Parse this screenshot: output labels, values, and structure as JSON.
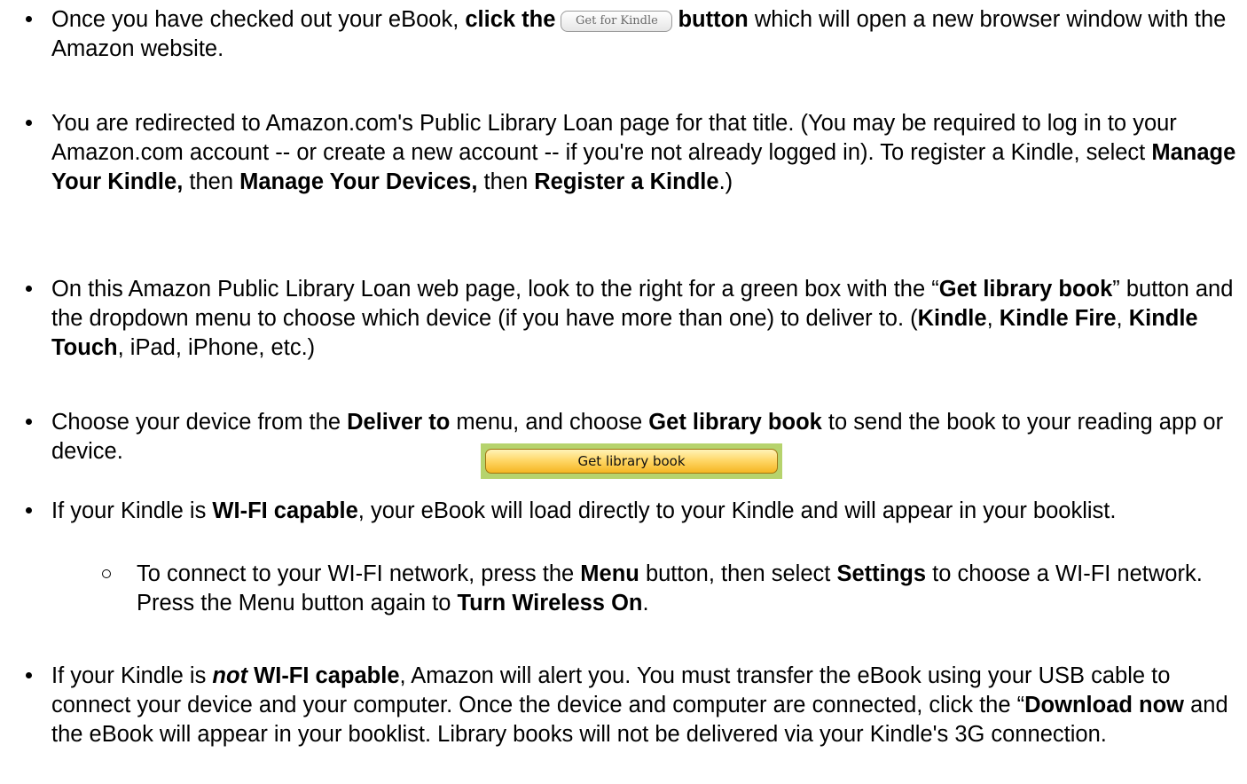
{
  "items": [
    {
      "a": "Once you have checked out your eBook, ",
      "b": "click the",
      "button": "Get for Kindle",
      "c": "button",
      "d": " which will open a new browser window with the Amazon website."
    },
    {
      "a": "You are redirected to Amazon.com's Public Library Loan page for that title. (You may be required to log in to your Amazon.com account -- or create a new account -- if you're not already logged in). To register a Kindle, select ",
      "b": "Manage Your Kindle,",
      "c": " then ",
      "d": "Manage Your Devices,",
      "e": " then ",
      "f": "Register a Kindle",
      "g": ".)"
    },
    {
      "a": "On this Amazon Public Library Loan  web page,  look to the right for a green box with the “",
      "b": "Get library book",
      "c": "” button and the dropdown menu to choose which device (if you have more than one) to deliver to. (",
      "d": "Kindle",
      "e": ", ",
      "f": "Kindle Fire",
      "g": ", ",
      "h": "Kindle Touch",
      "i": ", iPad, iPhone, etc.)"
    },
    {
      "a": "Choose your device from the ",
      "b": "Deliver to",
      "c": " menu, and choose ",
      "d": "Get library book",
      "e": " to send the book to your reading app or device.",
      "button": "Get library book"
    },
    {
      "a": "If your Kindle is ",
      "b": "WI-FI capable",
      "c": ", your eBook will load directly to your Kindle and will appear in your booklist.",
      "sub": {
        "a": "To connect to your WI-FI network, press the ",
        "b": "Menu",
        "c": " button, then select ",
        "d": "Settings",
        "e": " to choose a WI-FI network. Press the Menu button again to ",
        "f": "Turn Wireless On",
        "g": "."
      }
    },
    {
      "a": "If your Kindle is ",
      "b": "not",
      "c": " WI-FI capable",
      "d": ", Amazon will alert you. You must transfer the eBook using your USB cable to connect your device and your computer.  Once the device and computer are connected, click the “",
      "e": "Download now",
      "f": " and the eBook will appear in your booklist.  Library books will not be delivered via your Kindle's 3G connection."
    }
  ]
}
